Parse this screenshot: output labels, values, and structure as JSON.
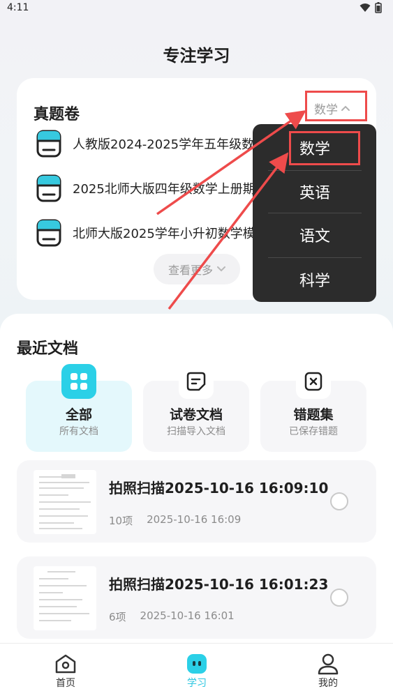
{
  "status_bar": {
    "time": "4:11"
  },
  "page": {
    "title": "专注学习"
  },
  "exam_card": {
    "title": "真题卷",
    "dropdown_value": "数学",
    "items": [
      {
        "label": "人教版2024-2025学年五年级数学上期..."
      },
      {
        "label": "2025北师大版四年级数学上册期末复..."
      },
      {
        "label": "北师大版2025学年小升初数学模拟试卷"
      }
    ],
    "more_label": "查看更多"
  },
  "recent": {
    "title": "最近文档",
    "categories": [
      {
        "label": "全部",
        "sub": "所有文档"
      },
      {
        "label": "试卷文档",
        "sub": "扫描导入文档"
      },
      {
        "label": "错题集",
        "sub": "已保存错题"
      }
    ],
    "docs": [
      {
        "name": "拍照扫描2025-10-16 16:09:10",
        "count": "10项",
        "time": "2025-10-16 16:09"
      },
      {
        "name": "拍照扫描2025-10-16 16:01:23",
        "count": "6项",
        "time": "2025-10-16 16:01"
      }
    ]
  },
  "dropdown_menu": {
    "items": [
      {
        "label": "数学"
      },
      {
        "label": "英语"
      },
      {
        "label": "语文"
      },
      {
        "label": "科学"
      }
    ]
  },
  "bottom_nav": {
    "items": [
      {
        "label": "首页"
      },
      {
        "label": "学习"
      },
      {
        "label": "我的"
      }
    ]
  },
  "colors": {
    "accent": "#2bd0e7",
    "annotation": "#ee4b4b",
    "menu_bg": "#2c2c2c"
  }
}
